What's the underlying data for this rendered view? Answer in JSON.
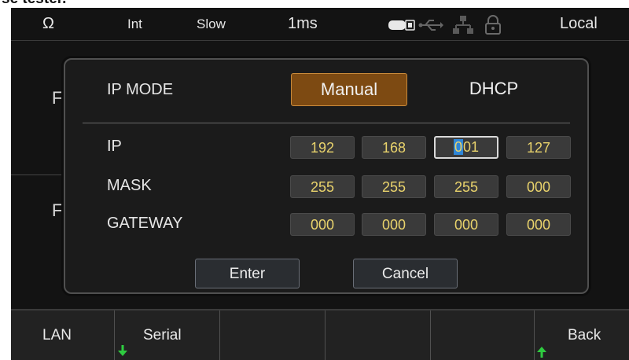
{
  "caption_fragment": "se tester.",
  "status": {
    "omega": "Ω",
    "integration": "Int",
    "speed": "Slow",
    "interval": "1ms",
    "mode": "Local",
    "icons": [
      "battery-icon",
      "usb-icon",
      "network-icon",
      "lock-icon"
    ]
  },
  "background": {
    "letter1": "F",
    "letter2": "F"
  },
  "dialog": {
    "ip_mode_label": "IP MODE",
    "mode_options": [
      "Manual",
      "DHCP"
    ],
    "selected_mode": "Manual",
    "rows": [
      {
        "label": "IP",
        "octets": [
          "192",
          "168",
          "001",
          "127"
        ],
        "focused_octet": 2
      },
      {
        "label": "MASK",
        "octets": [
          "255",
          "255",
          "255",
          "000"
        ]
      },
      {
        "label": "GATEWAY",
        "octets": [
          "000",
          "000",
          "000",
          "000"
        ]
      }
    ],
    "focused_cursor_char": "0",
    "focused_rest": "01",
    "enter_label": "Enter",
    "cancel_label": "Cancel"
  },
  "softkeys": {
    "lan": "LAN",
    "serial": "Serial",
    "back": "Back",
    "empty_count": 3
  },
  "colors": {
    "manual_bg": "#7d4a12",
    "octet_text": "#e9d36c",
    "arrow_green": "#2ecc40",
    "cursor_blue": "#2f86d6"
  }
}
